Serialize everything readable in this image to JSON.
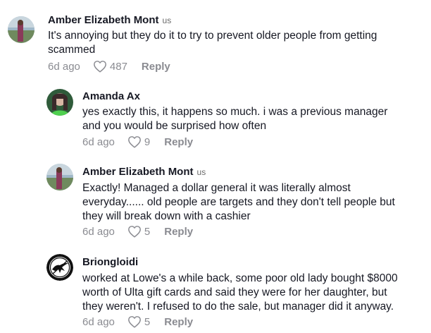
{
  "comments": [
    {
      "username": "Amber Elizabeth Mont",
      "tag": "us",
      "lines": [
        "It's annoying but they do it to try to prevent older people from getting",
        "scammed"
      ],
      "time": "6d ago",
      "likes": "487",
      "reply_label": "Reply",
      "avatar_icon": "landscape-avatar"
    },
    {
      "username": "Amanda Ax",
      "tag": "",
      "lines": [
        "yes exactly this, it happens so much. i was a previous manager",
        "and you would be surprised how often"
      ],
      "time": "6d ago",
      "likes": "9",
      "reply_label": "Reply",
      "avatar_icon": "portrait-avatar"
    },
    {
      "username": "Amber Elizabeth Mont",
      "tag": "us",
      "lines": [
        "Exactly! Managed a dollar general it was literally almost",
        "everyday...... old people are targets and they don't tell people but",
        "they will break down with a cashier"
      ],
      "time": "6d ago",
      "likes": "5",
      "reply_label": "Reply",
      "avatar_icon": "landscape-avatar"
    },
    {
      "username": "Briongloidi",
      "tag": "",
      "lines": [
        "worked at Lowe's a while back, some poor old lady bought $8000",
        "worth of Ulta gift cards and said they were for her daughter, but",
        "they weren't. I refused to do the sale, but manager did it anyway."
      ],
      "time": "6d ago",
      "likes": "5",
      "reply_label": "Reply",
      "avatar_icon": "mockingjay-avatar"
    }
  ],
  "colors": {
    "text": "#161823",
    "muted": "#8a8b91",
    "background": "#ffffff"
  }
}
